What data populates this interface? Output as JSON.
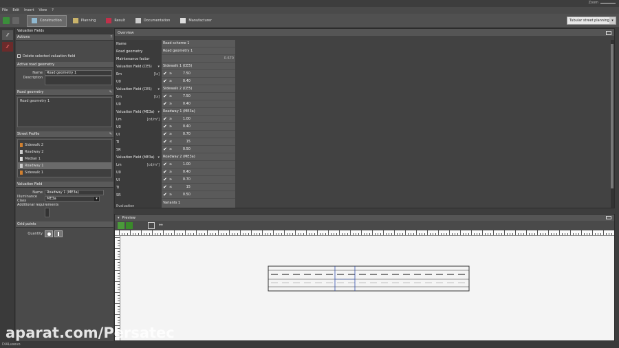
{
  "menu": [
    "File",
    "Edit",
    "Insert",
    "View",
    "?"
  ],
  "zoom_label": "Zoom",
  "tabs": [
    {
      "label": "Construction",
      "active": true,
      "color": "#8fb8d0"
    },
    {
      "label": "Planning",
      "active": false,
      "color": "#c9b36a"
    },
    {
      "label": "Result",
      "active": false,
      "color": "#c0304a"
    },
    {
      "label": "Documentation",
      "active": false,
      "color": "#cccccc"
    },
    {
      "label": "Manufacturer",
      "active": false,
      "color": "#dddddd"
    }
  ],
  "planning_select": "Tubular street planning",
  "left": {
    "section_title": "Valuation Fields",
    "actions_title": "Actions",
    "delete_btn": "Delete selected valuation field",
    "active_title": "Active road geometry",
    "name_label": "Name",
    "name_value": "Road geometry 1",
    "desc_label": "Description",
    "desc_value": "",
    "road_geometry_title": "Road geometry",
    "road_geometry_items": [
      "Road geometry 1"
    ],
    "street_profile_title": "Street Profile",
    "street_profile_items": [
      {
        "label": "Sidewalk 2",
        "sel": false,
        "color": "#d08030"
      },
      {
        "label": "Roadway 2",
        "sel": false,
        "color": "#cccccc"
      },
      {
        "label": "Median 1",
        "sel": false,
        "color": "#dddddd"
      },
      {
        "label": "Roadway 1",
        "sel": true,
        "color": "#cccccc"
      },
      {
        "label": "Sidewalk 1",
        "sel": false,
        "color": "#d08030"
      }
    ],
    "valuation_title": "Valuation Field",
    "vf_name_label": "Name",
    "vf_name_value": "Roadway 1 (ME3a)",
    "illum_label": "Illuminance Class",
    "illum_value": "ME3a",
    "additional_label": "Additional requirements",
    "grid_title": "Grid points",
    "quantity_label": "Quantity"
  },
  "overview": {
    "title": "Overview",
    "names": [
      {
        "t": "Name",
        "u": ""
      },
      {
        "t": "Road geometry",
        "u": ""
      },
      {
        "t": "Maintenance factor",
        "u": ""
      },
      {
        "t": "Valuation Field (CE5)",
        "u": "▾"
      },
      {
        "t": "Em",
        "u": "[lx]"
      },
      {
        "t": "U0",
        "u": ""
      },
      {
        "t": "Valuation Field (CE5)",
        "u": "▾"
      },
      {
        "t": "Em",
        "u": "[lx]"
      },
      {
        "t": "U0",
        "u": ""
      },
      {
        "t": "Valuation Field (ME3a)",
        "u": "▾"
      },
      {
        "t": "Lm",
        "u": "[cd/m²]"
      },
      {
        "t": "U0",
        "u": ""
      },
      {
        "t": "Ul",
        "u": ""
      },
      {
        "t": "TI",
        "u": ""
      },
      {
        "t": "SR",
        "u": ""
      },
      {
        "t": "Valuation Field (ME3a)",
        "u": "▾"
      },
      {
        "t": "Lm",
        "u": "[cd/m²]"
      },
      {
        "t": "U0",
        "u": ""
      },
      {
        "t": "Ul",
        "u": ""
      },
      {
        "t": "TI",
        "u": ""
      },
      {
        "t": "SR",
        "u": ""
      }
    ],
    "values": [
      {
        "t": "Road scheme 1",
        "c": false,
        "v": "",
        "r": ""
      },
      {
        "t": "Road geometry 1",
        "c": false,
        "v": "",
        "r": ""
      },
      {
        "t": "",
        "c": false,
        "v": "",
        "r": "0.670"
      },
      {
        "t": "Sidewalk 1 (CE5)",
        "c": false,
        "v": "",
        "r": ""
      },
      {
        "t": "≥",
        "c": true,
        "v": "7.50",
        "r": ""
      },
      {
        "t": "≥",
        "c": true,
        "v": "0.40",
        "r": ""
      },
      {
        "t": "Sidewalk 2 (CE5)",
        "c": false,
        "v": "",
        "r": ""
      },
      {
        "t": "≥",
        "c": true,
        "v": "7.50",
        "r": ""
      },
      {
        "t": "≥",
        "c": true,
        "v": "0.40",
        "r": ""
      },
      {
        "t": "Roadway 1 (ME3a)",
        "c": false,
        "v": "",
        "r": ""
      },
      {
        "t": "≥",
        "c": true,
        "v": "1.00",
        "r": ""
      },
      {
        "t": "≥",
        "c": true,
        "v": "0.40",
        "r": ""
      },
      {
        "t": "≥",
        "c": true,
        "v": "0.70",
        "r": ""
      },
      {
        "t": "≤",
        "c": true,
        "v": "15",
        "r": ""
      },
      {
        "t": "≥",
        "c": true,
        "v": "0.50",
        "r": ""
      },
      {
        "t": "Roadway 2 (ME3a)",
        "c": false,
        "v": "",
        "r": ""
      },
      {
        "t": "≥",
        "c": true,
        "v": "1.00",
        "r": ""
      },
      {
        "t": "≥",
        "c": true,
        "v": "0.40",
        "r": ""
      },
      {
        "t": "≥",
        "c": true,
        "v": "0.70",
        "r": ""
      },
      {
        "t": "≤",
        "c": true,
        "v": "15",
        "r": ""
      },
      {
        "t": "≥",
        "c": true,
        "v": "0.50",
        "r": ""
      }
    ],
    "footer_left": "Evaluation",
    "footer_right": "Variants 1"
  },
  "preview": {
    "title": "Preview"
  },
  "status": "DIALuxevo",
  "watermark": "aparat.com/Persatec"
}
